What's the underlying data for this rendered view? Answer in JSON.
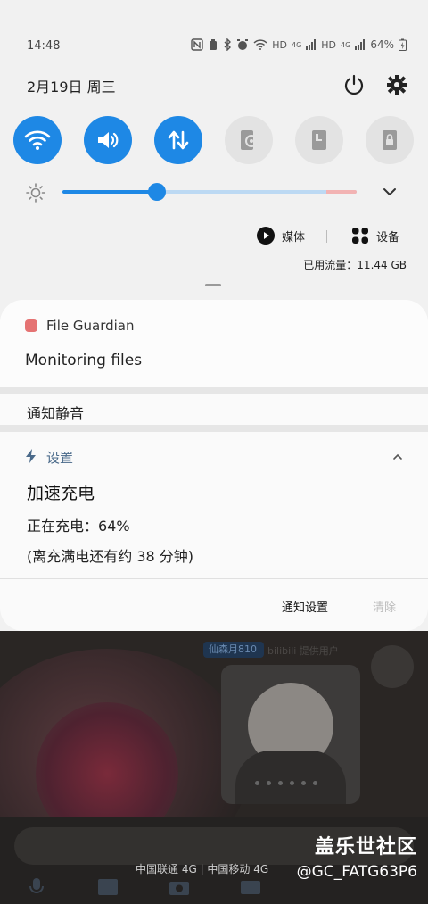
{
  "status_bar": {
    "time": "14:48",
    "network_labels": [
      "HD",
      "4G",
      "HD",
      "4G"
    ],
    "battery": "64%"
  },
  "header": {
    "date": "2月19日 周三",
    "power_icon": "power-icon",
    "settings_icon": "gear-icon"
  },
  "quick_tiles": [
    {
      "name": "wifi",
      "icon": "wifi-icon",
      "state": "on"
    },
    {
      "name": "sound",
      "icon": "volume-icon",
      "state": "on"
    },
    {
      "name": "mobile-data",
      "icon": "data-arrows-icon",
      "state": "on"
    },
    {
      "name": "hotspot",
      "icon": "hotspot-icon",
      "state": "off"
    },
    {
      "name": "portrait",
      "icon": "portrait-lock-icon",
      "state": "off"
    },
    {
      "name": "secure-folder",
      "icon": "lock-icon",
      "state": "off"
    }
  ],
  "brightness": {
    "level": 0.32
  },
  "media": {
    "label": "媒体",
    "devices_label": "设备"
  },
  "data_usage": "已用流量：11.44 GB",
  "notifications": {
    "file_guardian": {
      "app": "File Guardian",
      "text": "Monitoring files"
    },
    "silent_header": "通知静音",
    "charging": {
      "app": "设置",
      "title": "加速充电",
      "line1": "正在充电：64%",
      "line2": "(离充满电还有约 38 分钟)"
    },
    "notification_settings": "通知设置",
    "clear": "清除"
  },
  "background": {
    "badge": "仙森月810",
    "badge_text": "bilibili 提供用户",
    "carrier": "中国联通 4G | 中国移动 4G",
    "watermark_title": "盖乐世社区",
    "watermark_user": "@GC_FATG63P6"
  },
  "colors": {
    "accent": "#1e88e5",
    "tile_off": "#e3e3e3",
    "app_icon": "#e57373"
  }
}
